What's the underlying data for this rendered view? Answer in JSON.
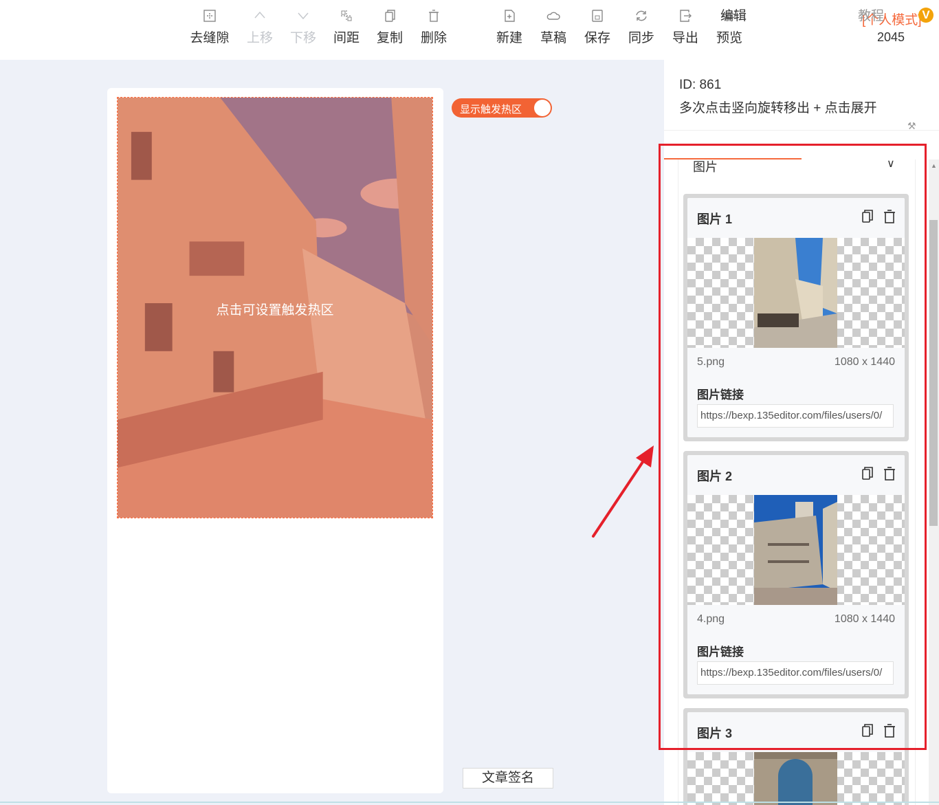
{
  "toolbar": {
    "items": [
      {
        "label": "去缝隙",
        "icon": "remove-gap-icon",
        "enabled": true
      },
      {
        "label": "上移",
        "icon": "chevron-up-icon",
        "enabled": false
      },
      {
        "label": "下移",
        "icon": "chevron-down-icon",
        "enabled": false
      },
      {
        "label": "间距",
        "icon": "spacing-icon",
        "enabled": true
      },
      {
        "label": "复制",
        "icon": "copy-icon",
        "enabled": true
      },
      {
        "label": "删除",
        "icon": "trash-icon",
        "enabled": true
      },
      {
        "label": "新建",
        "icon": "new-file-icon",
        "enabled": true
      },
      {
        "label": "草稿",
        "icon": "cloud-icon",
        "enabled": true
      },
      {
        "label": "保存",
        "icon": "save-icon",
        "enabled": true
      },
      {
        "label": "同步",
        "icon": "sync-icon",
        "enabled": true
      },
      {
        "label": "导出",
        "icon": "export-icon",
        "enabled": true
      },
      {
        "label": "预览",
        "icon": "eye-icon",
        "enabled": true
      }
    ],
    "mode": "[个人模式]",
    "badge": "V",
    "count": "2045"
  },
  "canvas": {
    "toggle_label": "显示触发热区",
    "toggle_on": true,
    "hotzone_label": "点击可设置触发热区",
    "signature_button": "文章签名"
  },
  "panel": {
    "id_text": "ID: 861",
    "description": "多次点击竖向旋转移出 + 点击展开",
    "tabs": [
      "编辑",
      "教程"
    ],
    "active_tab": "编辑",
    "section_title": "图片",
    "items": [
      {
        "title": "图片 1",
        "filename": "5.png",
        "size": "1080 x 1440",
        "link_label": "图片链接",
        "link": "https://bexp.135editor.com/files/users/0/"
      },
      {
        "title": "图片 2",
        "filename": "4.png",
        "size": "1080 x 1440",
        "link_label": "图片链接",
        "link": "https://bexp.135editor.com/files/users/0/"
      },
      {
        "title": "图片 3"
      }
    ]
  },
  "colors": {
    "accent": "#f5693c",
    "highlight": "#e5202b",
    "badge": "#f3a30b"
  }
}
